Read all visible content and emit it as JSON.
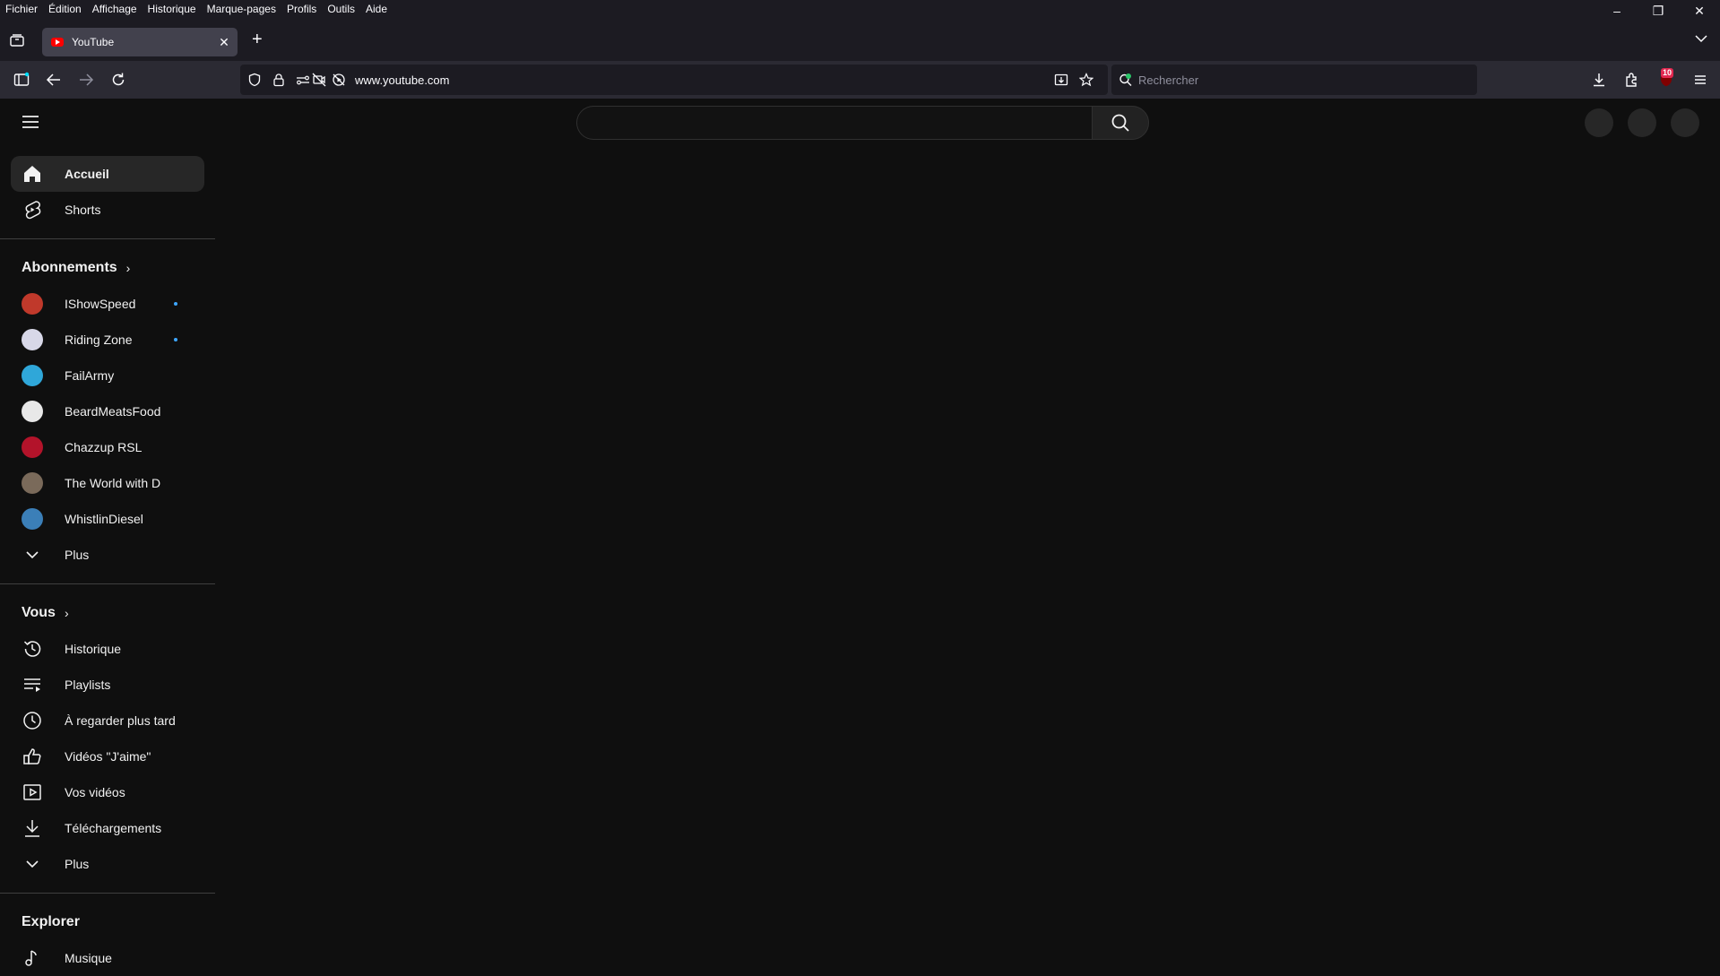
{
  "menubar": {
    "items": [
      "Fichier",
      "Édition",
      "Affichage",
      "Historique",
      "Marque-pages",
      "Profils",
      "Outils",
      "Aide"
    ]
  },
  "window_controls": {
    "minimize": "–",
    "restore": "❐",
    "close": "✕"
  },
  "tab": {
    "title": "YouTube",
    "close": "✕"
  },
  "newtab": "+",
  "urlbar": {
    "url": "www.youtube.com"
  },
  "searchbar": {
    "placeholder": "Rechercher"
  },
  "extension_badge": "10",
  "sidebar": {
    "main": [
      {
        "label": "Accueil",
        "icon": "home-icon",
        "active": true
      },
      {
        "label": "Shorts",
        "icon": "shorts-icon"
      }
    ],
    "subscriptions_title": "Abonnements",
    "subscriptions": [
      {
        "label": "IShowSpeed",
        "color": "#c0392b",
        "new": true
      },
      {
        "label": "Riding Zone",
        "color": "#d8d8e8",
        "new": true
      },
      {
        "label": "FailArmy",
        "color": "#2fa7d9",
        "new": false
      },
      {
        "label": "BeardMeatsFood",
        "color": "#e8e8e8",
        "new": false
      },
      {
        "label": "Chazzup RSL",
        "color": "#b3132a",
        "new": false
      },
      {
        "label": "The World with D",
        "color": "#7a6a5a",
        "new": false
      },
      {
        "label": "WhistlinDiesel",
        "color": "#3b7fb8",
        "new": false
      }
    ],
    "subscriptions_more": "Plus",
    "you_title": "Vous",
    "you": [
      {
        "label": "Historique",
        "icon": "history-icon"
      },
      {
        "label": "Playlists",
        "icon": "playlists-icon"
      },
      {
        "label": "À regarder plus tard",
        "icon": "watch-later-icon"
      },
      {
        "label": "Vidéos \"J'aime\"",
        "icon": "like-icon"
      },
      {
        "label": "Vos vidéos",
        "icon": "your-videos-icon"
      },
      {
        "label": "Téléchargements",
        "icon": "downloads-icon"
      }
    ],
    "you_more": "Plus",
    "explore_title": "Explorer",
    "explore": [
      {
        "label": "Musique",
        "icon": "music-icon"
      }
    ]
  }
}
